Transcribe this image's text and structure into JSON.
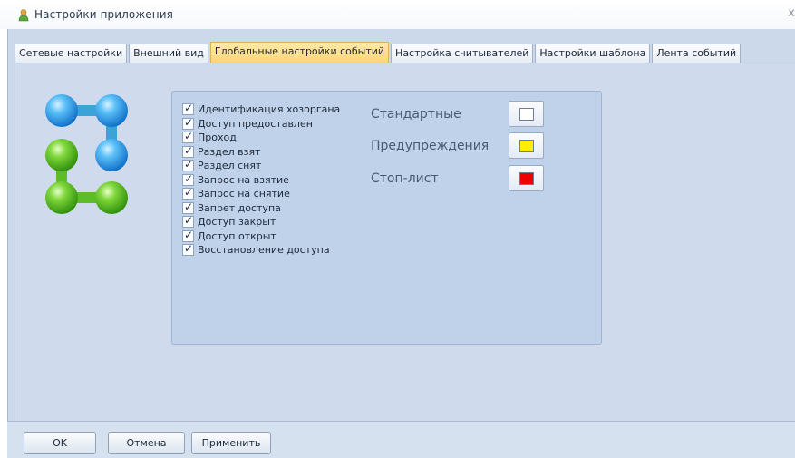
{
  "window": {
    "title": "Настройки приложения",
    "close_glyph": "x"
  },
  "tabs": [
    {
      "label": "Сетевые настройки"
    },
    {
      "label": "Внешний вид"
    },
    {
      "label": "Глобальные настройки событий"
    },
    {
      "label": "Настройка считывателей"
    },
    {
      "label": "Настройки шаблона"
    },
    {
      "label": "Лента событий"
    }
  ],
  "active_tab": "Глобальные настройки событий",
  "events": [
    {
      "label": "Идентификация хозоргана",
      "checked": true
    },
    {
      "label": "Доступ предоставлен",
      "checked": true
    },
    {
      "label": "Проход",
      "checked": true
    },
    {
      "label": "Раздел взят",
      "checked": true
    },
    {
      "label": "Раздел снят",
      "checked": true
    },
    {
      "label": "Запрос на взятие",
      "checked": true
    },
    {
      "label": "Запрос на снятие",
      "checked": true
    },
    {
      "label": "Запрет доступа",
      "checked": true
    },
    {
      "label": "Доступ закрыт",
      "checked": true
    },
    {
      "label": "Доступ открыт",
      "checked": true
    },
    {
      "label": "Восстановление доступа",
      "checked": true
    }
  ],
  "check_glyph": "✓",
  "color_settings": [
    {
      "label": "Стандартные",
      "color": "#ffffff"
    },
    {
      "label": "Предупреждения",
      "color": "#ffee00"
    },
    {
      "label": "Стоп-лист",
      "color": "#ee0000"
    }
  ],
  "buttons": {
    "ok": "OK",
    "cancel": "Отмена",
    "apply": "Применить"
  },
  "logo_colors": {
    "blue": "#2fa0ec",
    "green": "#55c21a",
    "link": "#3aa3d8"
  }
}
